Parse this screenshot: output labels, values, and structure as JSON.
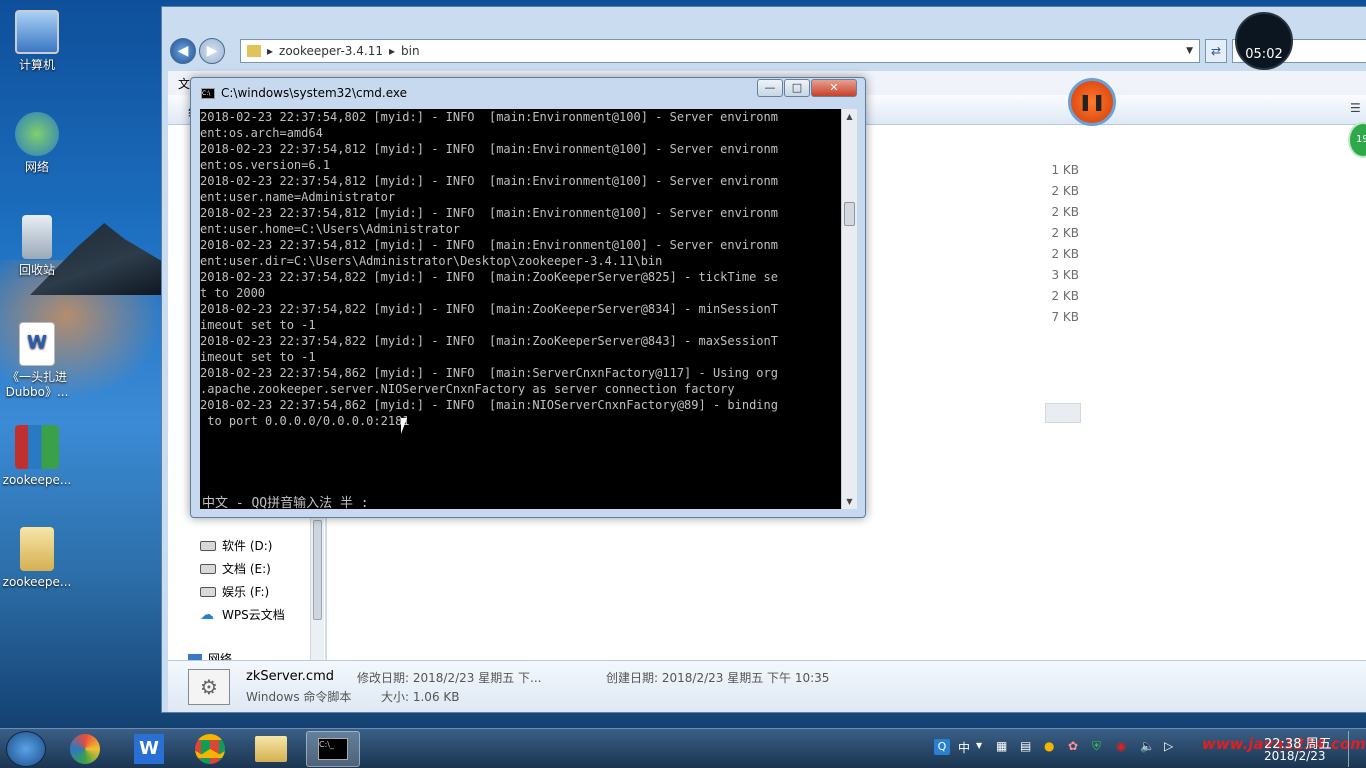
{
  "desktop": {
    "icons": [
      {
        "label": "计算机"
      },
      {
        "label": "网络"
      },
      {
        "label": "回收站"
      },
      {
        "label": "《一头扎进Dubbo》..."
      },
      {
        "label": "zookeepe..."
      },
      {
        "label": "zookeepe..."
      }
    ]
  },
  "explorer": {
    "breadcrumb": [
      "zookeeper-3.4.11",
      "bin"
    ],
    "menu_first": "文",
    "toolbar_first": "组",
    "tree": [
      "软件 (D:)",
      "文档 (E:)",
      "娱乐 (F:)",
      "WPS云文档",
      "网络"
    ],
    "sizes": [
      "1 KB",
      "2 KB",
      "2 KB",
      "2 KB",
      "2 KB",
      "3 KB",
      "2 KB",
      "7 KB"
    ],
    "details": {
      "name": "zkServer.cmd",
      "type": "Windows 命令脚本",
      "modified": "修改日期: 2018/2/23 星期五 下...",
      "created": "创建日期: 2018/2/23 星期五 下午 10:35",
      "size": "大小: 1.06 KB"
    }
  },
  "cmd": {
    "title": "C:\\windows\\system32\\cmd.exe",
    "lines": [
      "2018-02-23 22:37:54,802 [myid:] - INFO  [main:Environment@100] - Server environm",
      "ent:os.arch=amd64",
      "2018-02-23 22:37:54,812 [myid:] - INFO  [main:Environment@100] - Server environm",
      "ent:os.version=6.1",
      "2018-02-23 22:37:54,812 [myid:] - INFO  [main:Environment@100] - Server environm",
      "ent:user.name=Administrator",
      "2018-02-23 22:37:54,812 [myid:] - INFO  [main:Environment@100] - Server environm",
      "ent:user.home=C:\\Users\\Administrator",
      "2018-02-23 22:37:54,812 [myid:] - INFO  [main:Environment@100] - Server environm",
      "ent:user.dir=C:\\Users\\Administrator\\Desktop\\zookeeper-3.4.11\\bin",
      "2018-02-23 22:37:54,822 [myid:] - INFO  [main:ZooKeeperServer@825] - tickTime se",
      "t to 2000",
      "2018-02-23 22:37:54,822 [myid:] - INFO  [main:ZooKeeperServer@834] - minSessionT",
      "imeout set to -1",
      "2018-02-23 22:37:54,822 [myid:] - INFO  [main:ZooKeeperServer@843] - maxSessionT",
      "imeout set to -1",
      "2018-02-23 22:37:54,862 [myid:] - INFO  [main:ServerCnxnFactory@117] - Using org",
      ".apache.zookeeper.server.NIOServerCnxnFactory as server connection factory",
      "2018-02-23 22:37:54,862 [myid:] - INFO  [main:NIOServerCnxnFactory@89] - binding",
      " to port 0.0.0.0/0.0.0.0:2181"
    ],
    "ime_status": "中文 - QQ拼音输入法 半 :"
  },
  "overlay": {
    "timer": "05:02",
    "badge": "19"
  },
  "taskbar": {
    "ime_lang": "中",
    "watermark": "www.java1234.com",
    "clock_time": "22:38 周五",
    "clock_date": "2018/2/23"
  }
}
